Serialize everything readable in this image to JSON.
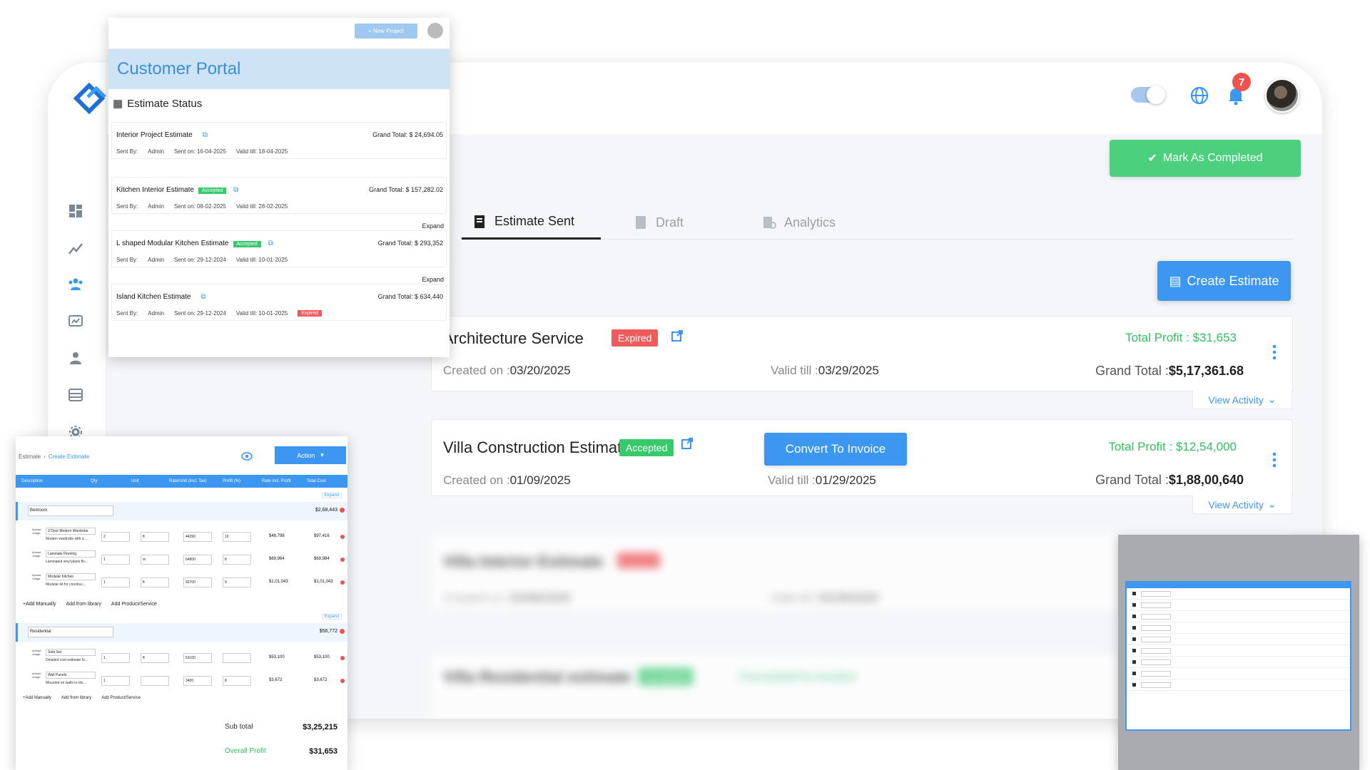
{
  "header": {
    "notification_count": "7",
    "mark_completed_label": "Mark As Completed"
  },
  "tabs": [
    {
      "label": "Estimate Sent",
      "active": true
    },
    {
      "label": "Draft",
      "active": false
    },
    {
      "label": "Analytics",
      "active": false
    }
  ],
  "create_estimate_label": "Create Estimate",
  "estimates": [
    {
      "title": "Architecture Service",
      "status": "Expired",
      "profit": "Total Profit : $31,653",
      "created_label": "Created on :",
      "created": "03/20/2025",
      "valid_label": "Valid till :",
      "valid": "03/29/2025",
      "grand_label": "Grand Total :",
      "grand": "$5,17,361.68",
      "view_activity": "View Activity"
    },
    {
      "title": "Villa Construction Estimate",
      "status": "Accepted",
      "convert_label": "Convert To Invoice",
      "profit": "Total Profit : $12,54,000",
      "created_label": "Created on :",
      "created": "01/09/2025",
      "valid_label": "Valid till :",
      "valid": "01/29/2025",
      "grand_label": "Grand Total :",
      "grand": "$1,88,00,640",
      "view_activity": "View Activity"
    },
    {
      "title": "Villa Interior Estimate",
      "created_label": "Created on :",
      "created": "02/06/2025",
      "valid_label": "Valid till :",
      "valid": "02/28/2025"
    },
    {
      "title": "Villa Residential estimate",
      "status": "Accepted",
      "converted_label": "Converted to Invoice"
    }
  ],
  "portal": {
    "new_project_label": "+ New Project",
    "title": "Customer Portal",
    "section": "Estimate Status",
    "sent_by_label": "Sent By:",
    "sender": "Admin",
    "expand_label": "Expand",
    "cards": [
      {
        "title": "Interior Project Estimate",
        "grand": "Grand Total: $ 24,694.05",
        "sent": "Sent on: 16-04-2025",
        "valid": "Valid till: 18-04-2025",
        "status": ""
      },
      {
        "title": "Kitchen Interior Estimate",
        "grand": "Grand Total: $ 157,282.02",
        "sent": "Sent on: 08-02-2025",
        "valid": "Valid till: 28-02-2025",
        "status": "Accepted"
      },
      {
        "title": "L shaped Modular Kitchen Estimate",
        "grand": "Grand Total: $ 293,352",
        "sent": "Sent on: 29-12-2024",
        "valid": "Valid till: 10-01-2025",
        "status": "Accepted"
      },
      {
        "title": "Island Kitchen Estimate",
        "grand": "Grand Total: $ 634,440",
        "sent": "Sent on: 29-12-2024",
        "valid": "Valid till: 10-01-2025",
        "status": "Expired"
      }
    ]
  },
  "create_estimate": {
    "crumb_root": "Estimate",
    "crumb_current": "Create Estimate",
    "action_label": "Action",
    "columns": [
      "Description",
      "Qty",
      "Unit",
      "Rate/Unit (Incl. Tax)",
      "Profit (%)",
      "Rate incl. Profit",
      "Total Cost"
    ],
    "expand_label": "Expand",
    "upload_label": "Upload Image",
    "groups": [
      {
        "name": "Bedroom",
        "amount": "$2,68,443",
        "rows": [
          {
            "name": "3 Door Modern Wardrobe",
            "desc": "Modern wardrobe with a ...",
            "qty": "2",
            "unit": "ft",
            "rate": "44390",
            "profit": "10",
            "incl": "$48,798",
            "total": "$97,416"
          },
          {
            "name": "Laminate Flooring",
            "desc": "Laminated vinyl plank flo...",
            "qty": "1",
            "unit": "m",
            "rate": "64800",
            "profit": "8",
            "incl": "$69,984",
            "total": "$69,984"
          },
          {
            "name": "Modular Kitchen",
            "desc": "Modular kit for construc...",
            "qty": "1",
            "unit": "ft",
            "rate": "92700",
            "profit": "9",
            "incl": "$1,01,043",
            "total": "$1,01,043"
          }
        ]
      },
      {
        "name": "Residential",
        "amount": "$56,772",
        "rows": [
          {
            "name": "Sofa Set",
            "desc": "Detailed cost estimate fo...",
            "qty": "1",
            "unit": "ft",
            "rate": "53100",
            "profit": "",
            "incl": "$53,100",
            "total": "$53,100"
          },
          {
            "name": "Wall Panels",
            "desc": "Mounted on walls to div...",
            "qty": "1",
            "unit": "",
            "rate": "3400",
            "profit": "8",
            "incl": "$3,672",
            "total": "$3,672"
          }
        ]
      }
    ],
    "add_manually": "+Add Manually",
    "add_library": "Add from library",
    "add_product": "Add Product/Service",
    "sub_total_label": "Sub total",
    "sub_total": "$3,25,215",
    "overall_profit_label": "Overall Profit",
    "overall_profit": "$31,653"
  },
  "colors": {
    "primary": "#3b97f0",
    "success": "#4cd07d",
    "danger": "#ef5a5a"
  }
}
